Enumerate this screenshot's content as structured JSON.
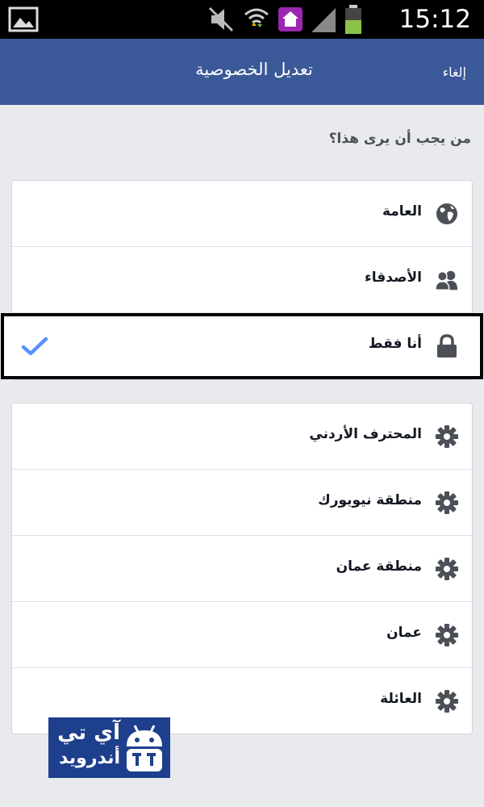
{
  "status_bar": {
    "time": "15:12",
    "icons": [
      "gallery-icon",
      "mute-icon",
      "wifi-icon",
      "home-app-icon",
      "signal-icon",
      "battery-icon"
    ]
  },
  "header": {
    "title": "تعديل الخصوصية",
    "cancel_label": "إلغاء",
    "color": "#3b5998"
  },
  "question": "من يجب أن يرى هذا؟",
  "audience_options": [
    {
      "label": "العامة",
      "icon": "globe-icon",
      "selected": false
    },
    {
      "label": "الأصدقاء",
      "icon": "friends-icon",
      "selected": false
    },
    {
      "label": "أنا فقط",
      "icon": "lock-icon",
      "selected": true
    }
  ],
  "custom_lists": [
    {
      "label": "المحترف الأردني",
      "icon": "gear-icon"
    },
    {
      "label": "منطقة نيويورك",
      "icon": "gear-icon"
    },
    {
      "label": "منطقة عمان",
      "icon": "gear-icon"
    },
    {
      "label": "عمان",
      "icon": "gear-icon"
    },
    {
      "label": "العائلة",
      "icon": "gear-icon"
    }
  ],
  "selection_check_color": "#5890ff",
  "watermark": {
    "line1": "آي تي",
    "line2": "أندرويد"
  }
}
